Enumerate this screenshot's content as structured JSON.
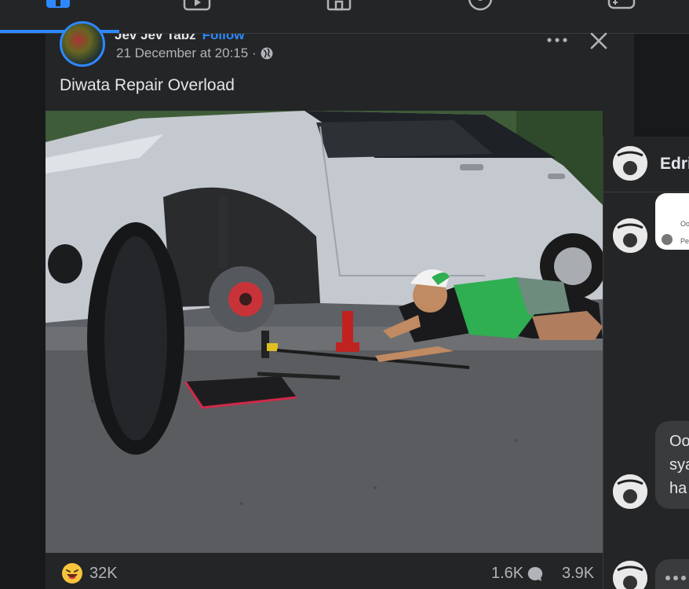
{
  "nav": {
    "tabs": [
      "home-icon",
      "video-icon",
      "marketplace-icon",
      "groups-icon",
      "gaming-icon"
    ]
  },
  "post": {
    "author": "Jev Jev Tabz",
    "follow_label": "Follow",
    "timestamp": "21 December at 20:15 ·",
    "caption": "Diwata Repair Overload",
    "reactions_count": "32K",
    "comments_count": "1.6K",
    "shares_count": "3.9K"
  },
  "comments_panel": {
    "title": "Edri",
    "white_bubble_line1": "Oo",
    "white_bubble_line2": "Pe",
    "dark_bubble_lines": [
      "Oo",
      "sya",
      "ha"
    ]
  },
  "colors": {
    "accent": "#2d88ff",
    "background": "#18191a",
    "surface": "#242526"
  }
}
